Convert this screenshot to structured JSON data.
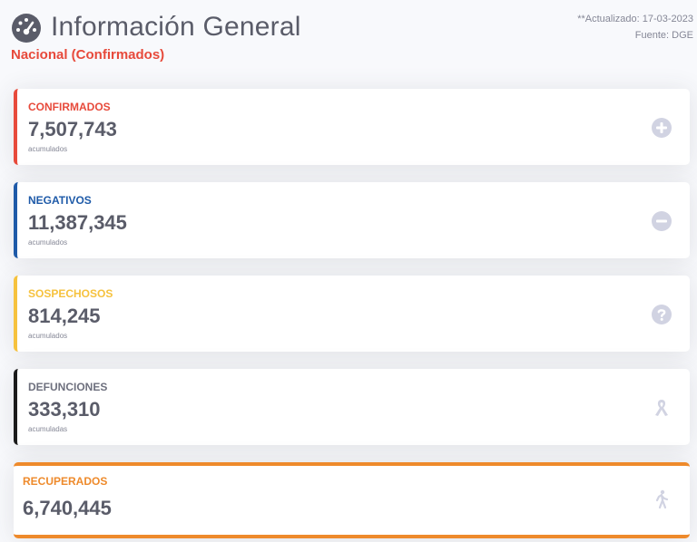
{
  "header": {
    "title": "Información General",
    "subtitle": "Nacional (Confirmados)",
    "updated": "**Actualizado: 17-03-2023",
    "source": "Fuente: DGE"
  },
  "cards": [
    {
      "label": "CONFIRMADOS",
      "value": "7,507,743",
      "sub": "acumulados",
      "color": "#e74a3b",
      "icon": "plus-circle-icon"
    },
    {
      "label": "NEGATIVOS",
      "value": "11,387,345",
      "sub": "acumulados",
      "color": "#1e5aa8",
      "icon": "minus-circle-icon"
    },
    {
      "label": "SOSPECHOSOS",
      "value": "814,245",
      "sub": "acumulados",
      "color": "#f6c23e",
      "icon": "question-circle-icon"
    },
    {
      "label": "DEFUNCIONES",
      "value": "333,310",
      "sub": "acumuladas",
      "color": "#1b1b1b",
      "icon": "ribbon-icon"
    },
    {
      "label": "RECUPERADOS",
      "value": "6,740,445",
      "sub": "",
      "color": "#ee8a2b",
      "icon": "walking-person-icon"
    }
  ]
}
